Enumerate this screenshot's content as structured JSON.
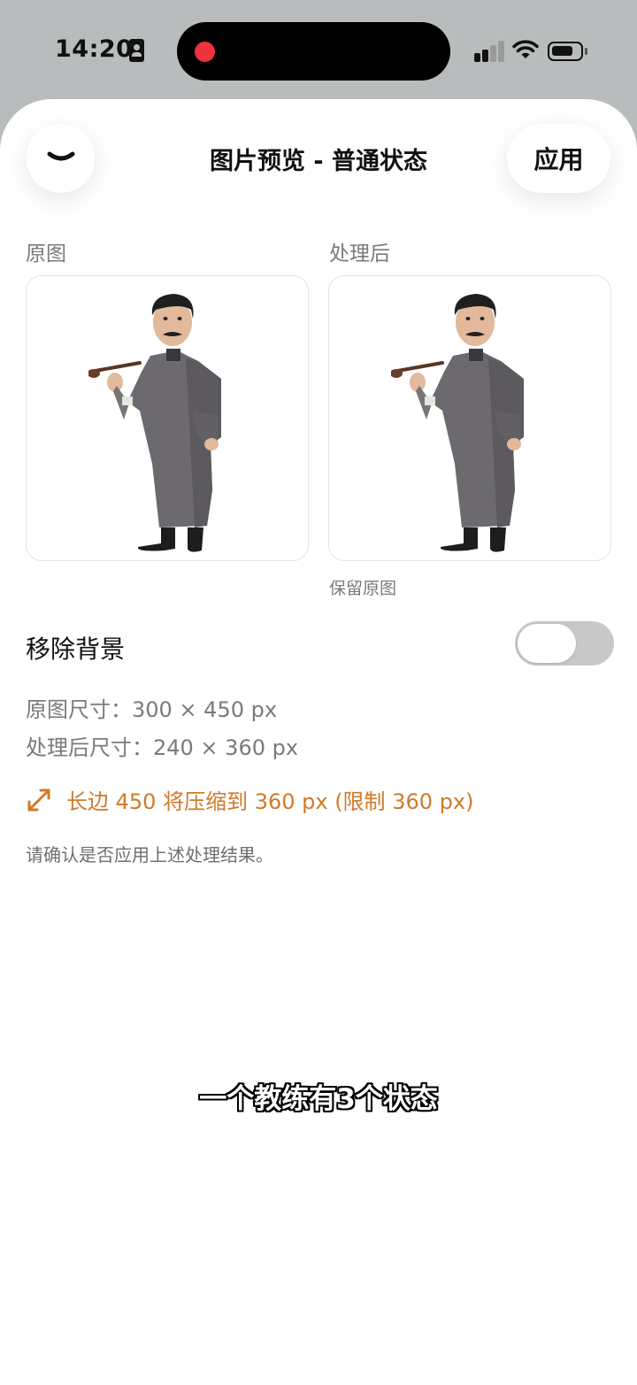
{
  "status_bar": {
    "time": "14:20",
    "icons": [
      "id-badge-icon",
      "recording-dot-icon",
      "cellular-signal-icon",
      "wifi-icon",
      "battery-icon"
    ]
  },
  "header": {
    "back_icon": "chevron-down-icon",
    "title": "图片预览 - 普通状态",
    "apply_label": "应用"
  },
  "preview": {
    "original_label": "原图",
    "processed_label": "处理后",
    "processed_caption": "保留原图"
  },
  "remove_background": {
    "label": "移除背景",
    "enabled": false
  },
  "info": {
    "original_size": "原图尺寸：300 × 450 px",
    "processed_size": "处理后尺寸：240 × 360 px",
    "compress_icon": "resize-arrows-icon",
    "compress_notice": "长边 450 将压缩到 360 px (限制 360 px)",
    "confirm_text": "请确认是否应用上述处理结果。"
  },
  "overlay": {
    "subtitle": "一个教练有3个状态"
  },
  "colors": {
    "background": "#b9bcbd",
    "sheet": "#ffffff",
    "accent_orange": "#d07a28",
    "muted_text": "#7a7a7a",
    "record_red": "#f0323c",
    "toggle_off": "#c8c8c8"
  }
}
